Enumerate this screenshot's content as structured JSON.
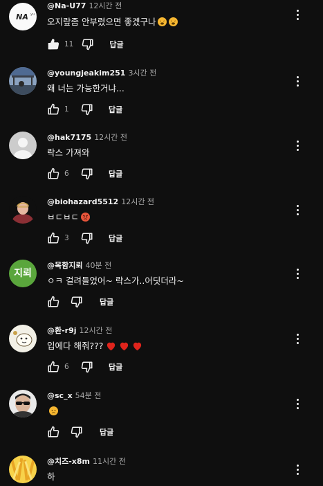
{
  "comments": [
    {
      "author": "@Na-U77",
      "time": "12시간 전",
      "text": "오지랖좀 안부렸으면 좋겠구나",
      "likes": "11",
      "reply": "답글",
      "avatar": "logo",
      "liked": true
    },
    {
      "author": "@youngjeakim251",
      "time": "3시간 전",
      "text": "왜 너는 가능한거냐...",
      "likes": "1",
      "reply": "답글",
      "avatar": "photo-sky"
    },
    {
      "author": "@hak7175",
      "time": "12시간 전",
      "text": "락스 가져와",
      "likes": "6",
      "reply": "답글",
      "avatar": "default-user"
    },
    {
      "author": "@biohazard5512",
      "time": "12시간 전",
      "text": "ㅂㄷㅂㄷ",
      "likes": "3",
      "reply": "답글",
      "avatar": "character"
    },
    {
      "author": "@목함지뢰",
      "time": "40분 전",
      "text": "ㅇㅋ 걸려들었어~  락스가..어딧더라~",
      "likes": "",
      "reply": "답글",
      "avatar": "initials",
      "initials": "지뢰"
    },
    {
      "author": "@환-r9j",
      "time": "12시간 전",
      "text": "입에다 해줘???",
      "likes": "6",
      "reply": "답글",
      "avatar": "drawing"
    },
    {
      "author": "@sc_x",
      "time": "54분 전",
      "text": "",
      "likes": "",
      "reply": "답글",
      "avatar": "sunglasses"
    },
    {
      "author": "@치즈-x8m",
      "time": "11시간 전",
      "text": "하",
      "likes": "",
      "reply": "답글",
      "avatar": "fries"
    }
  ],
  "icons": {
    "like": "thumbs-up-icon",
    "dislike": "thumbs-down-icon",
    "menu": "more-vert-icon",
    "tired_emoji": "tired-face-emoji",
    "angry_emoji": "angry-face-emoji",
    "sad_emoji": "sad-face-emoji",
    "heart": "red-heart-emoji"
  },
  "colors": {
    "background": "#0f0f0f",
    "text": "#f1f1f1",
    "secondary_text": "#aaaaaa",
    "initials_avatar": "#5aa63c",
    "heart": "#e0241c",
    "emoji": "#f7b731"
  }
}
